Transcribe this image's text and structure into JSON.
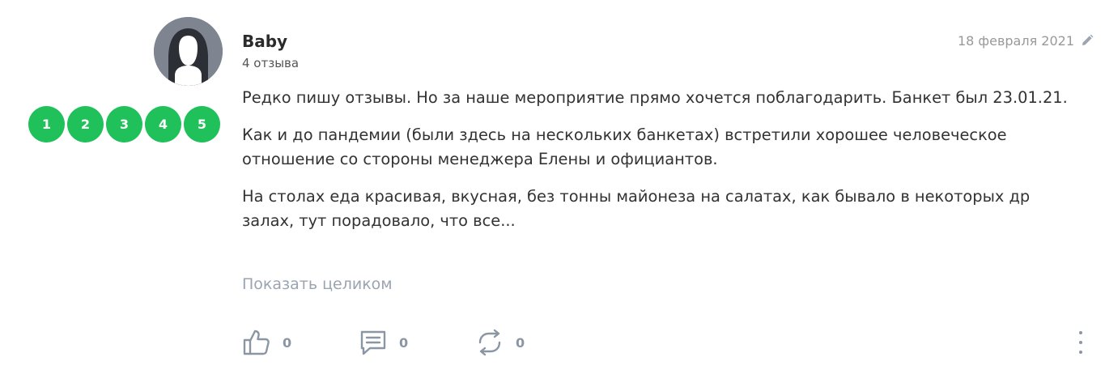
{
  "author": {
    "name": "Baby",
    "reviews_count": "4 отзыва",
    "avatar_icon": "user-silhouette-icon"
  },
  "rating": {
    "options": [
      "1",
      "2",
      "3",
      "4",
      "5"
    ],
    "color": "#20c05b"
  },
  "date": "18 февраля 2021",
  "edit_icon": "pencil-icon",
  "review": {
    "paragraphs": [
      "Редко пишу отзывы. Но за наше мероприятие прямо хочется поблагодарить. Банкет был 23.01.21.",
      "Как и до пандемии (были здесь на нескольких банкетах) встретили хорошее человеческое отношение со стороны менеджера Елены и официантов.",
      "На столах еда красивая, вкусная, без тонны майонеза на салатах, как бывало в некоторых др залах, тут порадовало, что все..."
    ],
    "show_more": "Показать целиком"
  },
  "actions": {
    "like": {
      "icon": "thumbs-up-icon",
      "count": "0"
    },
    "comment": {
      "icon": "comment-icon",
      "count": "0"
    },
    "repost": {
      "icon": "repost-icon",
      "count": "0"
    },
    "more_icon": "more-vertical-icon"
  }
}
